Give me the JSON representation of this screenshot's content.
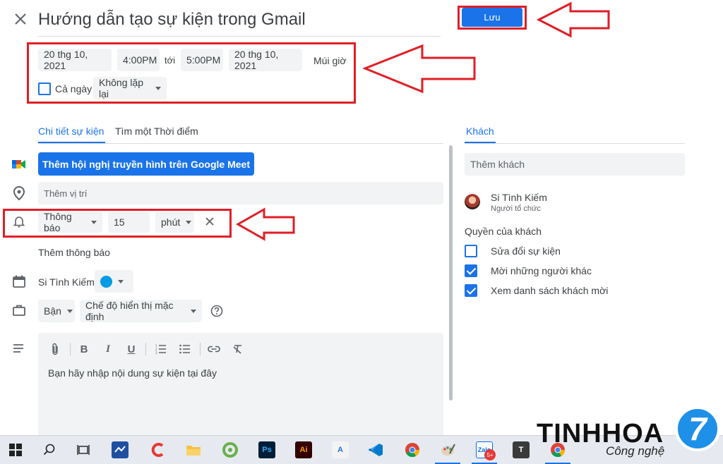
{
  "header": {
    "title": "Hướng dẫn tạo sự kiện trong Gmail",
    "save_label": "Lưu"
  },
  "datetime": {
    "start_date": "20 thg 10, 2021",
    "start_time": "4:00PM",
    "to_label": "tới",
    "end_time": "5:00PM",
    "end_date": "20 thg 10, 2021",
    "timezone_label": "Múi giờ",
    "all_day_label": "Cả ngày",
    "repeat_value": "Không lặp lại"
  },
  "tabs": {
    "details": "Chi tiết sự kiện",
    "find_time": "Tìm một Thời điểm",
    "guests": "Khách"
  },
  "details": {
    "meet_button": "Thêm hội nghị truyền hình trên Google Meet",
    "location_placeholder": "Thêm vị trí",
    "notification_type": "Thông báo",
    "notification_amount": "15",
    "notification_unit": "phút",
    "add_notification": "Thêm thông báo",
    "calendar_owner": "Si Tình Kiếm",
    "busy_value": "Bận",
    "visibility_value": "Chế độ hiển thị mặc định",
    "description_placeholder": "Bạn hãy nhập nội dung sự kiện tại đây"
  },
  "guests": {
    "add_placeholder": "Thêm khách",
    "organizer_name": "Si Tình Kiếm",
    "organizer_role": "Người tổ chức",
    "permissions_title": "Quyền của khách",
    "permissions": [
      {
        "label": "Sửa đổi sự kiện",
        "checked": false
      },
      {
        "label": "Mời những người khác",
        "checked": true
      },
      {
        "label": "Xem danh sách khách mời",
        "checked": true
      }
    ]
  },
  "watermark": {
    "brand": "TINHHOA",
    "sub": "Công nghệ",
    "digit": "7"
  },
  "taskbar": {
    "zalo_badge": "5+"
  },
  "colors": {
    "accent": "#1a73e8",
    "annotation_red": "#e01e26",
    "calendar_dot": "#039be5"
  }
}
